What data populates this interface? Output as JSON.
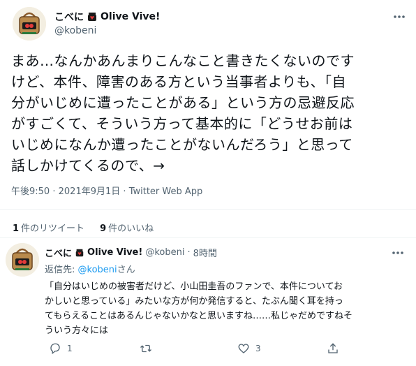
{
  "tweet": {
    "author_name": "こべに",
    "author_suffix": "Olive Vive!",
    "author_handle": "@kobeni",
    "text_lines": [
      "まあ…なんかあんまりこんなこと書きたくないのです",
      "けど、本件、障害のある方という当事者よりも、「自",
      "分がいじめに遭ったことがある」という方の忌避反応",
      "がすごくて、そういう方って基本的に「どうせお前は",
      "いじめになんか遭ったことがないんだろう」と思って",
      "話しかけてくるので、→"
    ],
    "time": "午後9:50",
    "date": "2021年9月1日",
    "source": "Twitter Web App",
    "meta_separator": "·",
    "retweets_count": "1",
    "retweets_label": "件のリツイート",
    "likes_count": "9",
    "likes_label": "件のいいね"
  },
  "reply": {
    "author_name": "こべに",
    "author_suffix": "Olive Vive!",
    "author_handle": "@kobeni",
    "separator": "·",
    "time_ago": "8時間",
    "reply_to_prefix": "返信先: ",
    "reply_to_handle": "@kobeni",
    "reply_to_suffix": "さん",
    "text_lines": [
      "「自分はいじめの被害者だけど、小山田圭吾のファンで、本件についてお",
      "かしいと思っている」みたいな方が何か発信すると、たぶん聞く耳を持っ",
      "てもらえることはあるんじゃないかなと思いますね……私じゃだめですねそ",
      "ういう方々には"
    ],
    "reply_count": "1",
    "retweet_count": "",
    "like_count": "3"
  },
  "colors": {
    "text": "#0f1419",
    "secondary": "#536471",
    "link": "#1d9bf0",
    "divider": "#eff3f4",
    "avatar_bg": "#f3eee1"
  },
  "icons": [
    "avatar-bag-icon",
    "broken-heart-icon",
    "more-icon",
    "reply-icon",
    "retweet-icon",
    "like-icon",
    "share-icon"
  ]
}
